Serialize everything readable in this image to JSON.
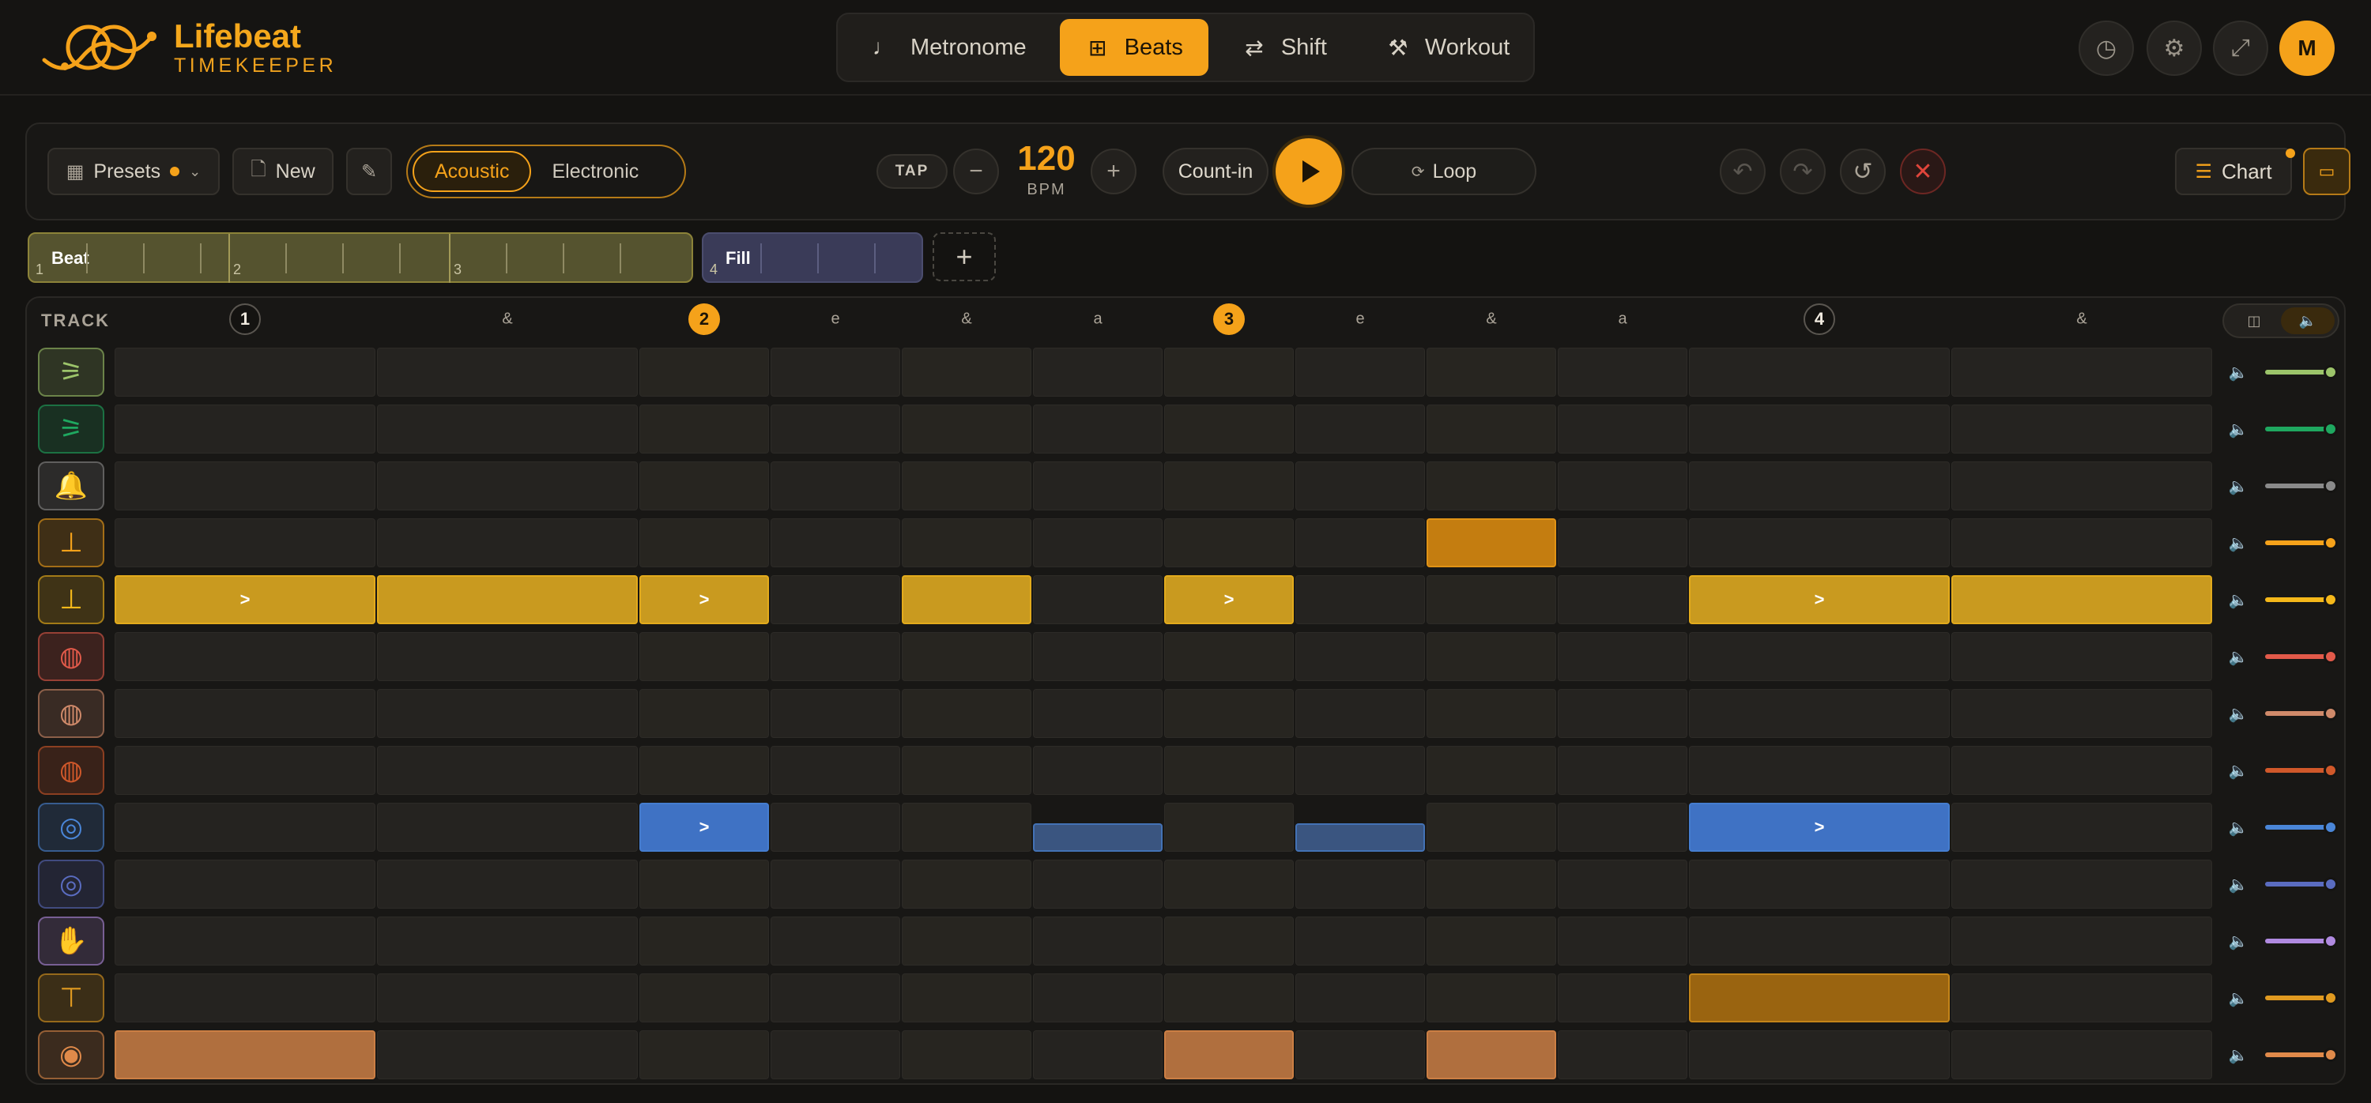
{
  "app": {
    "title": "Lifebeat",
    "subtitle": "TIMEKEEPER",
    "avatar_initial": "M",
    "accent": "#f5a21a"
  },
  "nav": [
    {
      "label": "Metronome",
      "icon": "note-icon",
      "active": false
    },
    {
      "label": "Beats",
      "icon": "grid-icon",
      "active": true
    },
    {
      "label": "Shift",
      "icon": "swap-icon",
      "active": false
    },
    {
      "label": "Workout",
      "icon": "dumbbell-icon",
      "active": false
    }
  ],
  "toolbar": {
    "presets_label": "Presets",
    "new_label": "New",
    "kits": [
      "Acoustic",
      "Electronic"
    ],
    "active_kit": "Acoustic",
    "tap_label": "TAP",
    "tempo": "120",
    "tempo_unit": "BPM",
    "countin_label": "Count-in",
    "loop_label": "Loop",
    "chart_label": "Chart"
  },
  "sections": {
    "beat": {
      "label": "Beat",
      "bars": [
        "1",
        "2",
        "3"
      ]
    },
    "fill": {
      "label": "Fill",
      "bars": [
        "4"
      ]
    },
    "add_label": "+"
  },
  "grid": {
    "track_header": "TRACK",
    "steps": [
      {
        "label": "1",
        "style": "plain"
      },
      {
        "label": "&",
        "style": "text"
      },
      {
        "label": "2",
        "style": "lit"
      },
      {
        "label": "e",
        "style": "text"
      },
      {
        "label": "&",
        "style": "text"
      },
      {
        "label": "a",
        "style": "text"
      },
      {
        "label": "3",
        "style": "lit"
      },
      {
        "label": "e",
        "style": "text"
      },
      {
        "label": "&",
        "style": "text"
      },
      {
        "label": "a",
        "style": "text"
      },
      {
        "label": "4",
        "style": "plain"
      },
      {
        "label": "&",
        "style": "text"
      }
    ],
    "accent_mark": ">",
    "tracks": [
      {
        "name": "hihat-open",
        "icon": "hihat-open-icon",
        "color": "#9cc46a",
        "hits": []
      },
      {
        "name": "hihat-pedal",
        "icon": "hihat-pedal-icon",
        "color": "#1fa860",
        "hits": []
      },
      {
        "name": "cowbell",
        "icon": "cowbell-icon",
        "color": "#8a8a8a",
        "hits": []
      },
      {
        "name": "crash",
        "icon": "crash-cymbal-icon",
        "color": "#f5a21a",
        "hits": [
          {
            "step": 8,
            "type": "full",
            "cell_color": "#c47d10"
          }
        ]
      },
      {
        "name": "ride",
        "icon": "ride-cymbal-icon",
        "color": "#f5b81a",
        "hits": [
          {
            "step": 0,
            "type": "accent",
            "cell_color": "#c99a1f"
          },
          {
            "step": 1,
            "type": "full",
            "cell_color": "#c99a1f"
          },
          {
            "step": 2,
            "type": "accent",
            "cell_color": "#c99a1f"
          },
          {
            "step": 4,
            "type": "full",
            "cell_color": "#c99a1f"
          },
          {
            "step": 6,
            "type": "accent",
            "cell_color": "#c99a1f"
          },
          {
            "step": 10,
            "type": "accent",
            "cell_color": "#c99a1f"
          },
          {
            "step": 11,
            "type": "full",
            "cell_color": "#c99a1f"
          }
        ]
      },
      {
        "name": "tom-high",
        "icon": "tom-icon",
        "color": "#e25a4a",
        "hits": []
      },
      {
        "name": "tom-mid",
        "icon": "tom-icon",
        "color": "#d08a6a",
        "hits": []
      },
      {
        "name": "tom-floor",
        "icon": "floor-tom-icon",
        "color": "#d0582a",
        "hits": []
      },
      {
        "name": "snare",
        "icon": "snare-icon",
        "color": "#4a86d8",
        "hits": [
          {
            "step": 2,
            "type": "accent",
            "cell_color": "#3f72c4"
          },
          {
            "step": 5,
            "type": "ghost",
            "cell_color": "#3a5580"
          },
          {
            "step": 7,
            "type": "ghost",
            "cell_color": "#3a5580"
          },
          {
            "step": 10,
            "type": "accent",
            "cell_color": "#3f72c4"
          }
        ]
      },
      {
        "name": "snare-rim",
        "icon": "snare-icon",
        "color": "#5a6cc0",
        "hits": []
      },
      {
        "name": "clap",
        "icon": "clap-icon",
        "color": "#b08ae0",
        "hits": []
      },
      {
        "name": "hihat-closed",
        "icon": "hihat-icon",
        "color": "#e09a20",
        "hits": [
          {
            "step": 10,
            "type": "full",
            "cell_color": "#9a6410"
          }
        ]
      },
      {
        "name": "kick",
        "icon": "kick-drum-icon",
        "color": "#e08a4a",
        "hits": [
          {
            "step": 0,
            "type": "full",
            "cell_color": "#b06f3e"
          },
          {
            "step": 6,
            "type": "full",
            "cell_color": "#b06f3e"
          },
          {
            "step": 8,
            "type": "full",
            "cell_color": "#b06f3e"
          }
        ]
      }
    ]
  }
}
